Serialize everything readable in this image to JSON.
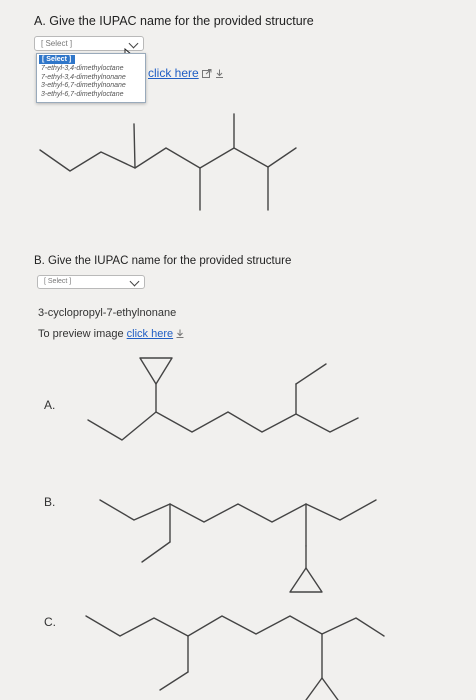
{
  "questionA": {
    "title": "A. Give the IUPAC name for the provided structure",
    "select_placeholder": "[ Select ]",
    "dropdown": {
      "highlighted": "[ Select ]",
      "options": [
        "7-ethyl-3,4-dimethyloctane",
        "7-ethyl-3,4-dimethylnonane",
        "3-ethyl-6,7-dimethylnonane",
        "3-ethyl-6,7-dimethyloctane"
      ]
    },
    "preview_link": "click here"
  },
  "questionB": {
    "title": "B. Give the IUPAC name for the provided structure",
    "select_placeholder": "[ Select ]",
    "compound_name": "3-cyclopropyl-7-ethylnonane",
    "preview_prefix": "To preview image",
    "preview_link": "click here",
    "options": [
      {
        "label": "A."
      },
      {
        "label": "B."
      },
      {
        "label": "C."
      }
    ]
  },
  "icons": {
    "external": "external-link-icon",
    "download": "download-icon",
    "cursor": "mouse-cursor-icon"
  }
}
